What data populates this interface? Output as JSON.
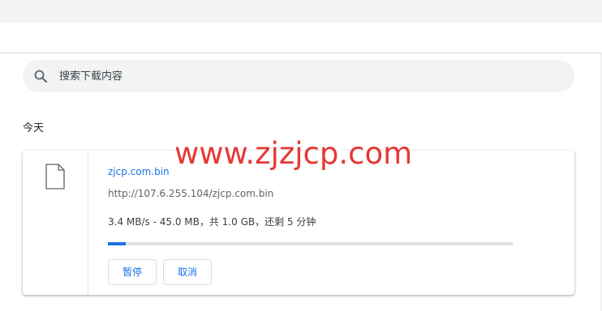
{
  "search": {
    "placeholder": "搜索下载内容",
    "icon": "search-icon"
  },
  "section": {
    "label": "今天"
  },
  "download": {
    "file_name": "zjcp.com.bin",
    "url": "http://107.6.255.104/zjcp.com.bin",
    "status": "3.4 MB/s - 45.0 MB，共 1.0 GB，还剩 5 分钟",
    "progress_percent": 4.4,
    "icon": "file-icon",
    "pause_label": "暂停",
    "cancel_label": "取消"
  },
  "watermark": {
    "text": "www.zjzjcp.com"
  },
  "colors": {
    "accent": "#1a73e8",
    "watermark": "#e53935",
    "topbar": "#f1f3f4"
  }
}
